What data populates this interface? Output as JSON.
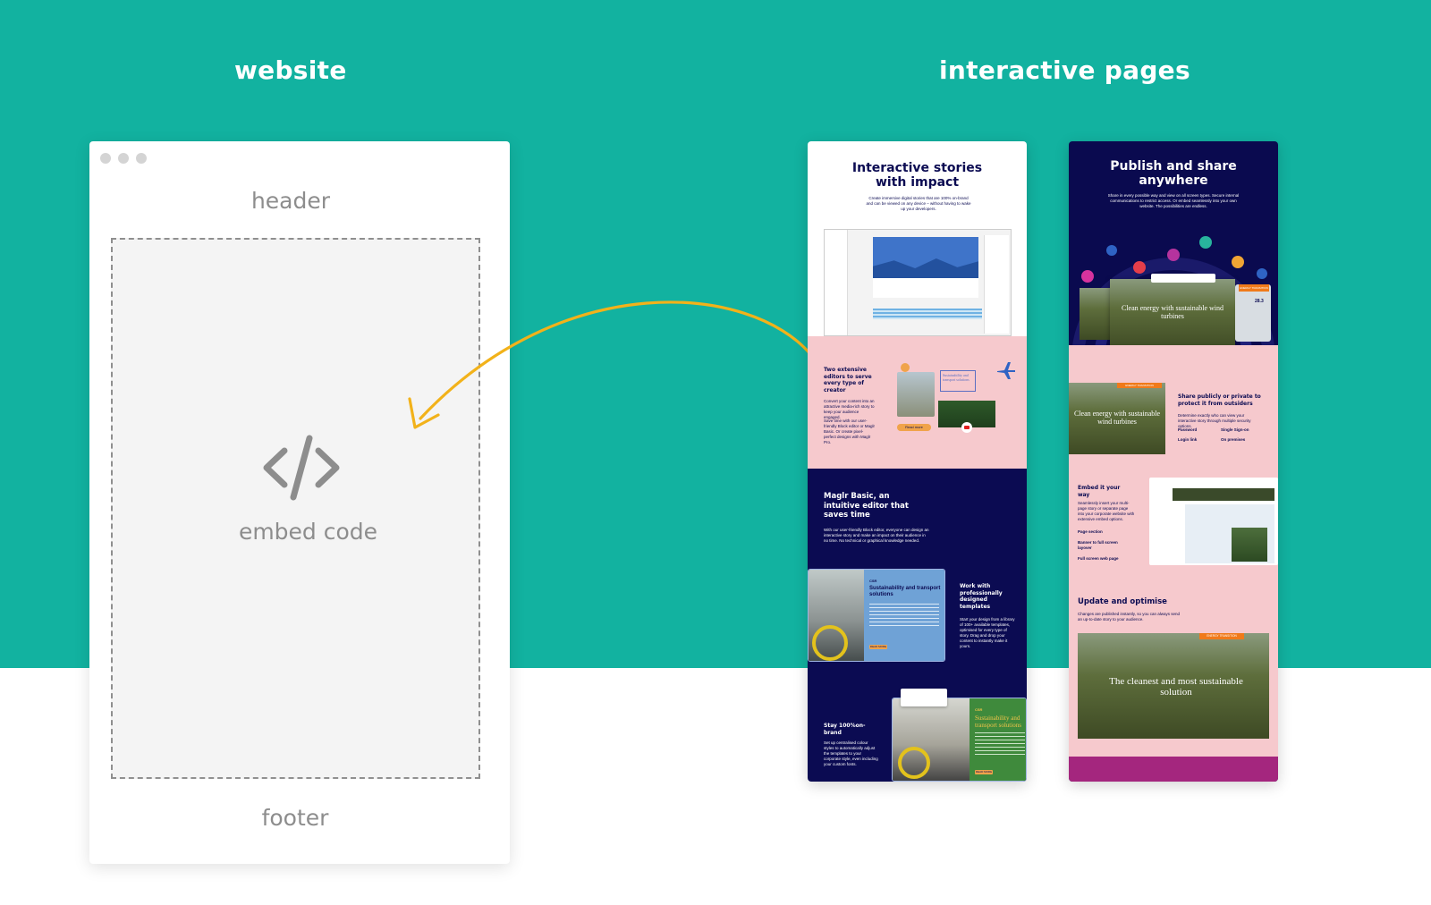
{
  "titles": {
    "website": "website",
    "interactive": "interactive pages"
  },
  "browser": {
    "header": "header",
    "embed": "embed code",
    "footer": "footer"
  },
  "page_a": {
    "hero_title_1": "Interactive stories",
    "hero_title_2": "with impact",
    "hero_body": "Create immersive digital stories that are 100% on-brand and can be viewed on any device – without having to wake up your developers.",
    "editors_title": "Two extensive editors to serve every type of creator",
    "editors_body_1": "Convert your content into an attractive media-rich story to keep your audience engaged.",
    "editors_body_2": "Save time with our user-friendly Block editor or Maglr Basic. Or create pixel-perfect designs with Maglr Pro.",
    "editors_button": "Read more",
    "card_label": "Sustainability and transport solutions",
    "basic_title": "Maglr Basic, an intuitive editor that saves time",
    "basic_body": "With our user-friendly Block editor, everyone can design an interactive story and make an impact on their audience in no time. No technical or graphical knowledge needed.",
    "template_card_tag": "CSR",
    "template_card_title": "Sustainability and transport solutions",
    "template_card_button": "READ MORE",
    "templates_title": "Work with professionally designed templates",
    "templates_body": "Start your design from a library of 100+ available templates, optimised for every type of story. Drag and drop your content to instantly make it yours.",
    "brand_title": "Stay 100%on-brand",
    "brand_body": "Set up centralised colour styles to automatically adjust the templates to your corporate style, even including your custom fonts.",
    "brand_card_tag": "CSR",
    "brand_card_title": "Sustainability and transport solutions",
    "brand_card_button": "READ MORE"
  },
  "page_b": {
    "hero_title_1": "Publish and share",
    "hero_title_2": "anywhere",
    "hero_body": "Share in every possible way and view on all screen types. Secure internal communications to restrict access. Or embed seamlessly into your own website. The possibilities are endless.",
    "hero_card_title": "Clean energy with sustainable wind turbines",
    "hero_card_tag": "ENERGY TRANSITION",
    "hero_card_stat": "28.3",
    "share_card_tag": "ENERGY TRANSITION",
    "share_card_title": "Clean energy with sustainable wind turbines",
    "share_title": "Share publicly or private to protect it from outsiders",
    "share_body": "Determine exactly who can view your interactive story through multiple security options.",
    "share_options": [
      "Password",
      "Single Sign-on",
      "Login link",
      "On premises"
    ],
    "embed_title": "Embed it your way",
    "embed_body": "Seamlessly insert your multi-page story or separate page into your corporate website with extensive embed options.",
    "embed_options": [
      "Page section",
      "Banner to full screen layover",
      "Full screen web page"
    ],
    "update_title": "Update and optimise",
    "update_body": "Changes are published instantly, so you can always send an up-to-date story to your audience.",
    "update_card_tag": "ENERGY TRANSITION",
    "update_card_title": "The cleanest and most sustainable solution"
  },
  "colors": {
    "teal": "#12b2a0",
    "navy": "#0b0b52",
    "pink": "#f6c9cd",
    "arrow": "#f2b21a",
    "magenta": "#a4267e"
  }
}
